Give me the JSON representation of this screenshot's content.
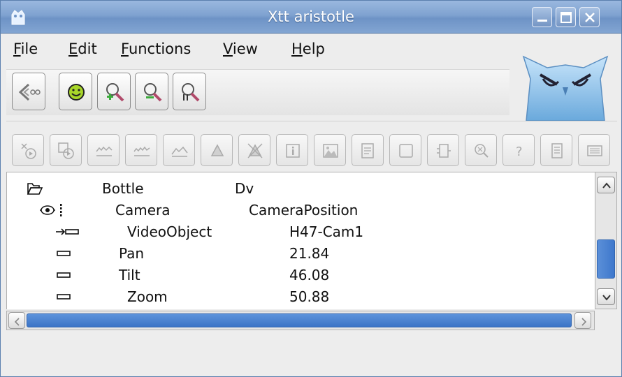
{
  "window": {
    "title": "Xtt aristotle"
  },
  "menu": [
    "File",
    "Edit",
    "Functions",
    "View",
    "Help"
  ],
  "menu_mnemonic": [
    "F",
    "E",
    "F",
    "V",
    "H"
  ],
  "menu_rest": [
    "ile",
    "dit",
    "unctions",
    "iew",
    "elp"
  ],
  "toolbar1": {
    "buttons": [
      {
        "icon": "navigator-back-icon"
      },
      {
        "icon": "smiley-icon"
      },
      {
        "icon": "zoom-in-icon"
      },
      {
        "icon": "zoom-out-icon"
      },
      {
        "icon": "zoom-reset-icon"
      }
    ]
  },
  "toolbar2": {
    "buttons": [
      {
        "icon": "open-object-icon"
      },
      {
        "icon": "open-plc-icon"
      },
      {
        "icon": "trend-icon"
      },
      {
        "icon": "fast-trend-icon"
      },
      {
        "icon": "history-icon"
      },
      {
        "icon": "alarm-icon"
      },
      {
        "icon": "block-alarm-icon"
      },
      {
        "icon": "info-icon"
      },
      {
        "icon": "graph-icon"
      },
      {
        "icon": "crossref-icon"
      },
      {
        "icon": "object-graph-icon"
      },
      {
        "icon": "classgraph-icon"
      },
      {
        "icon": "search-icon"
      },
      {
        "icon": "help-icon"
      },
      {
        "icon": "doc-icon"
      },
      {
        "icon": "rtnav-icon"
      }
    ]
  },
  "tree": {
    "rows": [
      {
        "icon": "folder-open-icon",
        "name": "Bottle",
        "value": "Dv"
      },
      {
        "icon": "object-attributes-icon",
        "name": "Camera",
        "value": "CameraPosition"
      },
      {
        "icon": "attribute-ref-icon",
        "name": "VideoObject",
        "value": "H47-Cam1"
      },
      {
        "icon": "attribute-icon",
        "name": "Pan",
        "value": "21.84"
      },
      {
        "icon": "attribute-icon",
        "name": "Tilt",
        "value": "46.08"
      },
      {
        "icon": "attribute-icon",
        "name": "Zoom",
        "value": "50.88"
      }
    ]
  },
  "colors": {
    "titlebar": "#7fa2d0",
    "accent": "#3e78cc",
    "owl": "#8fc2ea"
  },
  "scroll": {
    "vertical_position": 0.5,
    "horizontal_position": 0.0
  }
}
